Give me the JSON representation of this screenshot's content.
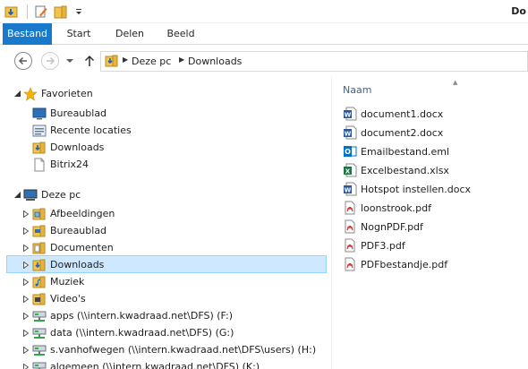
{
  "window": {
    "title": "Do"
  },
  "quick_access": [
    {
      "icon": "properties-icon"
    },
    {
      "icon": "edit-icon"
    },
    {
      "icon": "new-folder-icon"
    },
    {
      "icon": "customize-dropdown-icon"
    }
  ],
  "ribbon": {
    "tabs": [
      {
        "label": "Bestand",
        "active": true
      },
      {
        "label": "Start",
        "active": false
      },
      {
        "label": "Delen",
        "active": false
      },
      {
        "label": "Beeld",
        "active": false
      }
    ]
  },
  "address": {
    "crumbs": [
      "Deze pc",
      "Downloads"
    ]
  },
  "nav": {
    "favorites": {
      "label": "Favorieten",
      "items": [
        {
          "label": "Bureaublad",
          "icon": "desktop-icon"
        },
        {
          "label": "Recente locaties",
          "icon": "recent-places-icon"
        },
        {
          "label": "Downloads",
          "icon": "downloads-folder-icon"
        },
        {
          "label": "Bitrix24",
          "icon": "document-icon"
        }
      ]
    },
    "this_pc": {
      "label": "Deze pc",
      "items": [
        {
          "label": "Afbeeldingen",
          "icon": "pictures-folder-icon"
        },
        {
          "label": "Bureaublad",
          "icon": "desktop-folder-icon"
        },
        {
          "label": "Documenten",
          "icon": "documents-folder-icon"
        },
        {
          "label": "Downloads",
          "icon": "downloads-folder-icon",
          "selected": true
        },
        {
          "label": "Muziek",
          "icon": "music-folder-icon"
        },
        {
          "label": "Video's",
          "icon": "videos-folder-icon"
        },
        {
          "label": "apps (\\\\intern.kwadraad.net\\DFS) (F:)",
          "icon": "network-drive-icon"
        },
        {
          "label": "data (\\\\intern.kwadraad.net\\DFS) (G:)",
          "icon": "network-drive-icon"
        },
        {
          "label": "s.vanhofwegen (\\\\intern.kwadraad.net\\DFS\\users) (H:)",
          "icon": "network-drive-icon"
        },
        {
          "label": "algemeen (\\\\intern.kwadraad.net\\DFS) (K:)",
          "icon": "network-drive-icon"
        }
      ]
    }
  },
  "files": {
    "column_name": "Naam",
    "items": [
      {
        "label": "document1.docx",
        "type": "word"
      },
      {
        "label": "document2.docx",
        "type": "word"
      },
      {
        "label": "Emailbestand.eml",
        "type": "outlook"
      },
      {
        "label": "Excelbestand.xlsx",
        "type": "excel"
      },
      {
        "label": "Hotspot instellen.docx",
        "type": "word"
      },
      {
        "label": "loonstrook.pdf",
        "type": "pdf"
      },
      {
        "label": "NognPDF.pdf",
        "type": "pdf"
      },
      {
        "label": "PDF3.pdf",
        "type": "pdf"
      },
      {
        "label": "PDFbestandje.pdf",
        "type": "pdf"
      }
    ]
  },
  "colors": {
    "accent": "#1979ca",
    "selection_bg": "#cde8ff",
    "selection_border": "#99d1ff",
    "folder": "#e8b23c",
    "word": "#2b579a",
    "excel": "#217346",
    "outlook": "#0072c6",
    "pdf": "#d32f2f"
  }
}
